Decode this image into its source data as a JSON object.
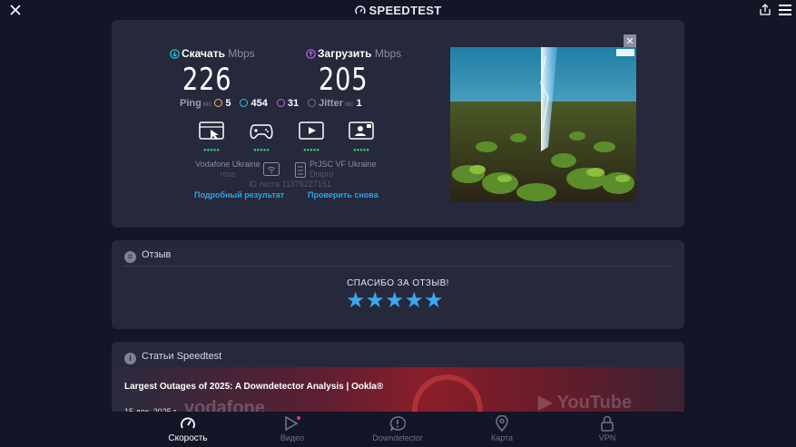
{
  "app": {
    "title": "SPEEDTEST",
    "icons": {
      "close": "close-icon",
      "share": "share-icon",
      "menu": "hamburger-menu-icon"
    }
  },
  "result": {
    "download": {
      "label": "Скачать",
      "unit": "Mbps",
      "value": "226"
    },
    "upload": {
      "label": "Загрузить",
      "unit": "Mbps",
      "value": "205"
    },
    "ping": {
      "label": "Ping",
      "unit": "мс",
      "idle": "5",
      "download": "454",
      "upload": "31"
    },
    "jitter": {
      "label": "Jitter",
      "unit": "мс",
      "value": "1"
    },
    "experience_icons": [
      "web-browsing-icon",
      "gaming-icon",
      "video-streaming-icon",
      "video-chat-icon"
    ],
    "provider": {
      "name": "Vodafone Ukraine",
      "sub": "ross"
    },
    "server": {
      "name": "PrJSC VF Ukraine",
      "city": "Dnipro"
    },
    "test_id": "ID теста 11376227151",
    "links": {
      "details": "Подробный результат",
      "retry": "Проверить снова"
    }
  },
  "feedback": {
    "title": "Отзыв",
    "thanks": "СПАСИБО ЗА ОТЗЫВ!",
    "rating": 5
  },
  "articles": {
    "title": "Статьи Speedtest",
    "items": [
      {
        "title": "Largest Outages of 2025: A Downdetector Analysis | Ookla®",
        "date": "15 дек. 2025 г."
      }
    ]
  },
  "nav": {
    "items": [
      {
        "label": "Скорость",
        "icon": "speedometer-icon",
        "active": true
      },
      {
        "label": "Видео",
        "icon": "play-icon",
        "active": false
      },
      {
        "label": "Downdetector",
        "icon": "alert-bubble-icon",
        "active": false
      },
      {
        "label": "Карта",
        "icon": "map-pin-icon",
        "active": false
      },
      {
        "label": "VPN",
        "icon": "lock-icon",
        "active": false
      }
    ]
  },
  "colors": {
    "background": "#141526",
    "card": "#26283b",
    "accent": "#2aa6e8",
    "good": "#2dd27a"
  }
}
